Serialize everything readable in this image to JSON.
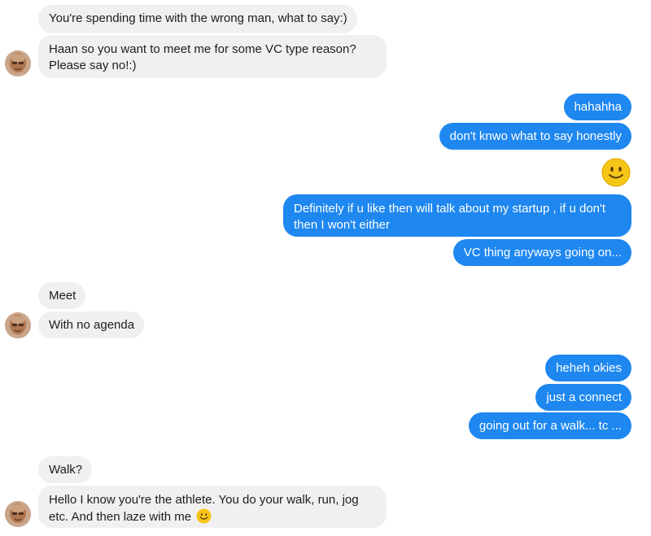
{
  "colors": {
    "incoming_bg": "#f1f0f0",
    "outgoing_bg": "#1e87f0",
    "incoming_text": "#1d1d1d",
    "outgoing_text": "#ffffff"
  },
  "messages": [
    {
      "side": "incoming",
      "text": "You're spending time with the wrong man, what to say:)"
    },
    {
      "side": "incoming",
      "text": "Haan so you want to meet me for some VC type reason? Please say no!:)"
    },
    {
      "side": "outgoing",
      "text": "hahahha"
    },
    {
      "side": "outgoing",
      "text": "don't knwo what to say honestly"
    },
    {
      "side": "outgoing",
      "emoji": "smiley-emoji"
    },
    {
      "side": "outgoing",
      "text": "Definitely if u like then will talk about my startup , if u don't then I won't either"
    },
    {
      "side": "outgoing",
      "text": "VC thing anyways going on..."
    },
    {
      "side": "incoming",
      "text": "Meet"
    },
    {
      "side": "incoming",
      "text": "With no agenda"
    },
    {
      "side": "outgoing",
      "text": "heheh okies"
    },
    {
      "side": "outgoing",
      "text": "just a connect"
    },
    {
      "side": "outgoing",
      "text": "going out for a walk... tc ..."
    },
    {
      "side": "incoming",
      "text": "Walk?"
    },
    {
      "side": "incoming",
      "text": "Hello I know you're the athlete. You do your walk, run, jog etc. And then laze with me",
      "trailing_emoji": "smiley-emoji"
    }
  ]
}
